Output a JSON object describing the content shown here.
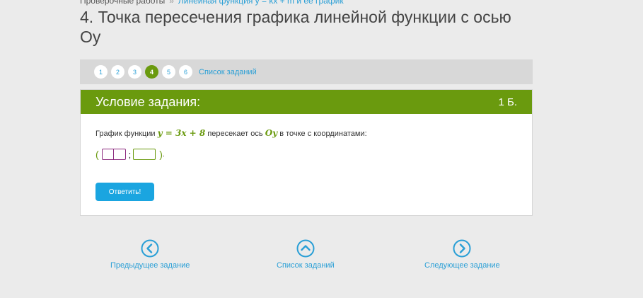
{
  "breadcrumb": {
    "root": "Проверочные работы",
    "topic": "Линейная функция y = kx + m и ее график"
  },
  "title": "4. Точка пересечения графика линейной функции с осью Оу",
  "pager": {
    "pages": [
      "1",
      "2",
      "3",
      "4",
      "5",
      "6"
    ],
    "active_index": 3,
    "task_list_label": "Список заданий"
  },
  "task": {
    "header": "Условие задания:",
    "points": "1 Б.",
    "text_before": "График функции",
    "formula": "y = 3x + 8",
    "text_middle": "пересекает ось",
    "axis": "Oy",
    "text_after": "в точке с координатами:",
    "open_paren": "(",
    "separator": ";",
    "close_paren": ")",
    "period": ".",
    "answer_x": "",
    "answer_y": ""
  },
  "submit_label": "Ответить!",
  "bottom_nav": {
    "prev": "Предыдущее задание",
    "list": "Список заданий",
    "next": "Следующее задание"
  },
  "colors": {
    "accent_green": "#6a9a0e",
    "link_blue": "#2a9fd6",
    "button_blue": "#1aa5e0"
  }
}
